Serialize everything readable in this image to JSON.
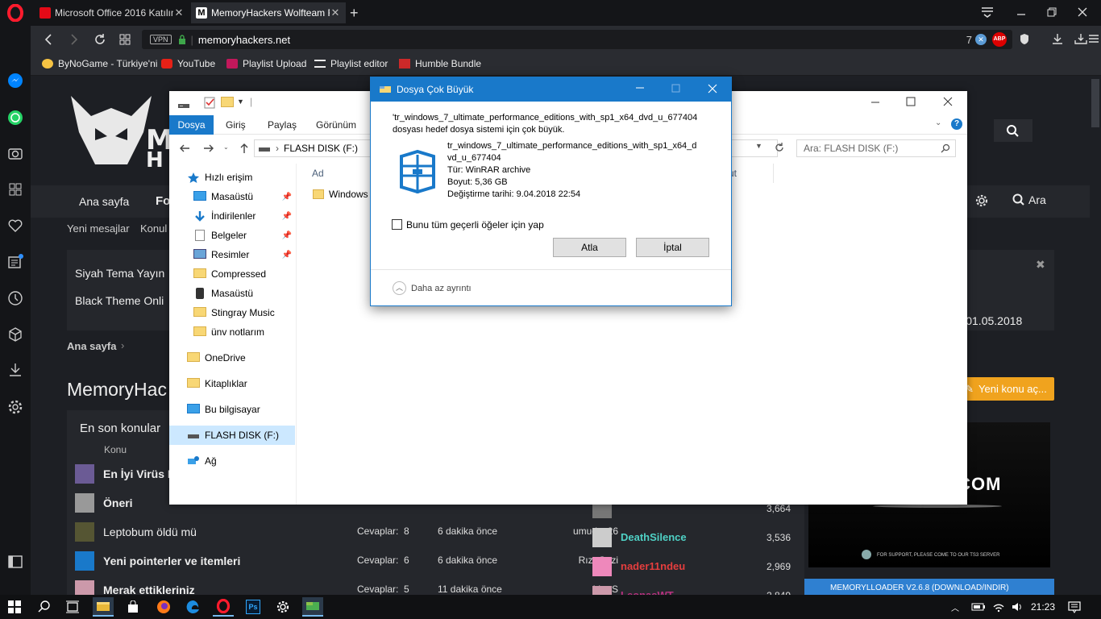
{
  "browser": {
    "tabs": [
      {
        "title": "Microsoft Office 2016 Katılım",
        "active": false
      },
      {
        "title": "MemoryHackers Wolfteam F",
        "active": true
      }
    ],
    "new_tab": "+",
    "vpn_badge": "VPN",
    "url": "memoryhackers.net",
    "tracker_count": "7",
    "adblock_label": "ABP",
    "bookmarks": [
      "ByNoGame - Türkiye'ni",
      "YouTube",
      "Playlist Upload",
      "Playlist editor",
      "Humble Bundle"
    ]
  },
  "site": {
    "logo_chars": [
      "M",
      "H"
    ],
    "nav": [
      "Ana sayfa",
      "Fo"
    ],
    "nav_search": "Ara",
    "subnav": [
      "Yeni mesajlar",
      "Konul"
    ],
    "notice_line1": "Siyah Tema Yayın",
    "notice_line2": "Black Theme Onli",
    "notice_date": "tes) 01.05.2018",
    "breadcrumb": "Ana sayfa",
    "page_title": "MemoryHac",
    "new_thread_button": "Yeni konu aç...",
    "latest_title": "En son konular",
    "col_header": "Konu",
    "threads": [
      {
        "title": "En İyi Virüs P",
        "replies": "",
        "time": "",
        "user": ""
      },
      {
        "title": "Öneri",
        "replies": "",
        "time": "",
        "user": ""
      },
      {
        "title": "Leptobum öldü mü",
        "replies": "Cevaplar:  8",
        "time": "6 dakika önce",
        "user": "umudos26"
      },
      {
        "title": "Yeni pointerler ve itemleri",
        "replies": "Cevaplar:  6",
        "time": "6 dakika önce",
        "user": "RızaGazi"
      },
      {
        "title": "Merak ettikleriniz",
        "replies": "Cevaplar:  5",
        "time": "11 dakika önce",
        "user": "VowS"
      }
    ],
    "members": [
      {
        "name": "",
        "count": "3,664"
      },
      {
        "name": "DeathSilence",
        "count": "3,536",
        "color": "#4fd1c5"
      },
      {
        "name": "nader11ndeu",
        "count": "2,969",
        "color": "#e53e3e"
      },
      {
        "name": "LeonasWT",
        "count": "2,849",
        "color": "#b83280"
      }
    ],
    "banner_text": ".COM",
    "banner_sub": "FOR SUPPORT, PLEASE COME TO OUR TS3 SERVER",
    "loader_bar": "MEMORYLLOADER V2.6.8 (DOWNLOAD/INDIR)"
  },
  "explorer": {
    "ribbon_tabs": [
      "Dosya",
      "Giriş",
      "Paylaş",
      "Görünüm"
    ],
    "path": "FLASH DISK (F:)",
    "search_placeholder": "Ara: FLASH DISK (F:)",
    "col_name": "Ad",
    "col_other": "ut",
    "file": "Windows",
    "nav": [
      {
        "label": "Hızlı erişim",
        "pin": false
      },
      {
        "label": "Masaüstü",
        "pin": true
      },
      {
        "label": "İndirilenler",
        "pin": true
      },
      {
        "label": "Belgeler",
        "pin": true
      },
      {
        "label": "Resimler",
        "pin": true
      },
      {
        "label": "Compressed",
        "pin": false
      },
      {
        "label": "Masaüstü",
        "pin": false
      },
      {
        "label": "Stingray Music",
        "pin": false
      },
      {
        "label": "ünv notlarım",
        "pin": false
      },
      {
        "label": "OneDrive",
        "pin": false
      },
      {
        "label": "Kitaplıklar",
        "pin": false
      },
      {
        "label": "Bu bilgisayar",
        "pin": false
      },
      {
        "label": "FLASH DISK (F:)",
        "pin": false,
        "selected": true
      },
      {
        "label": "Ağ",
        "pin": false
      }
    ]
  },
  "dialog": {
    "title": "Dosya Çok Büyük",
    "message_line1": "'tr_windows_7_ultimate_performance_editions_with_sp1_x64_dvd_u_677404",
    "message_line2": "dosyası hedef dosya sistemi için çok büyük.",
    "file_name_line1": "tr_windows_7_ultimate_performance_editions_with_sp1_x64_d",
    "file_name_line2": "vd_u_677404",
    "type": "Tür: WinRAR archive",
    "size": "Boyut: 5,36 GB",
    "modified": "Değiştirme tarihi: 9.04.2018 22:54",
    "checkbox_label": "Bunu tüm geçerli öğeler için yap",
    "skip_button": "Atla",
    "cancel_button": "İptal",
    "less_details": "Daha az ayrıntı"
  },
  "taskbar": {
    "time": "21:23"
  }
}
